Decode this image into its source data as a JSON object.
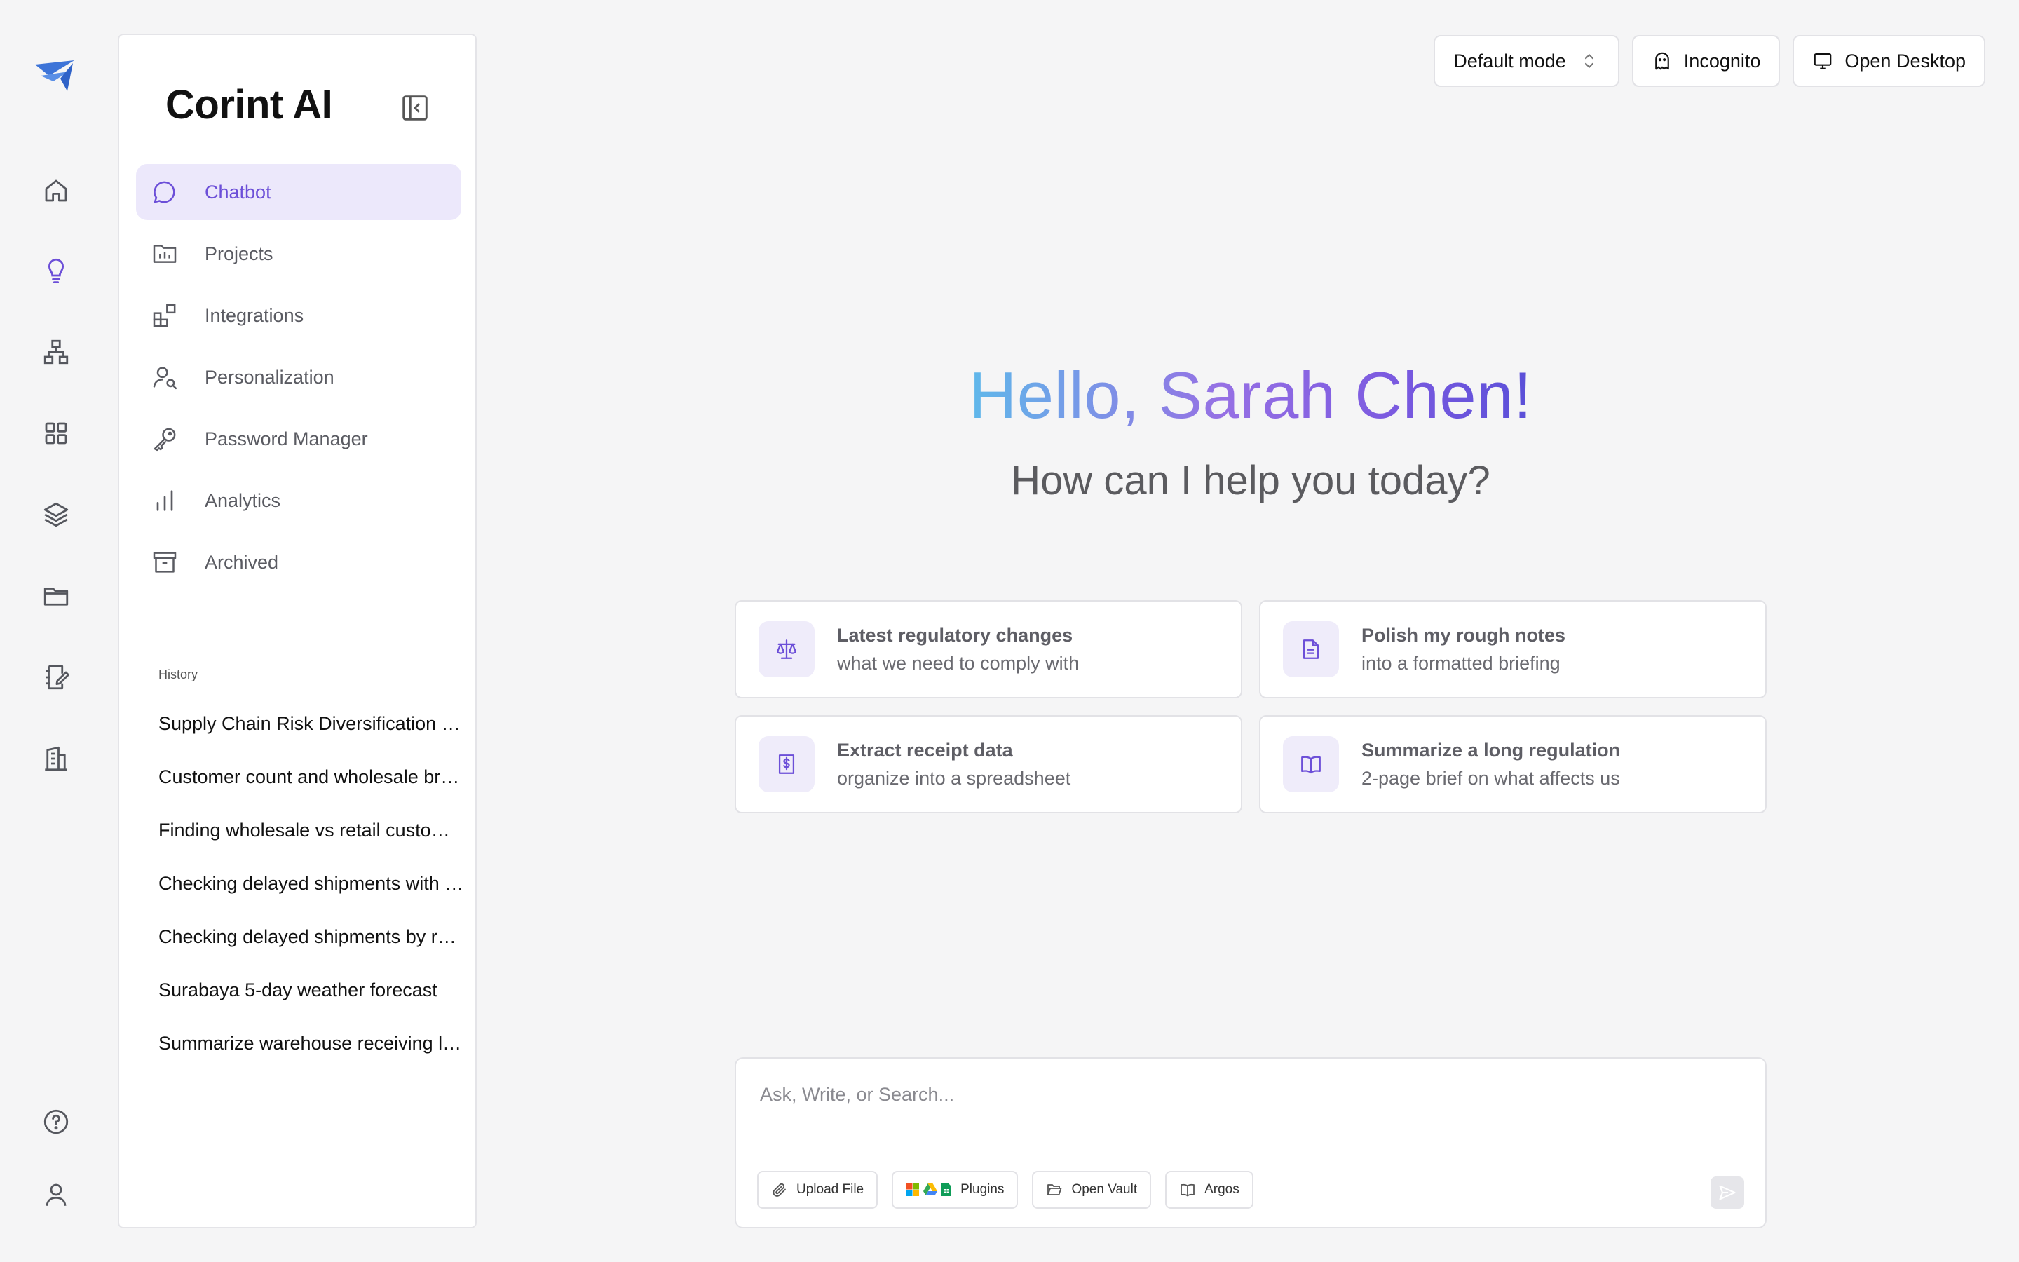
{
  "app": {
    "name": "Corint AI"
  },
  "rail": {
    "items": [
      "home-icon",
      "lightbulb-icon",
      "org-chart-icon",
      "grid-icon",
      "layers-icon",
      "folder-icon",
      "notebook-edit-icon",
      "building-icon"
    ],
    "bottom": [
      "help-icon",
      "user-icon"
    ]
  },
  "nav": {
    "items": [
      {
        "label": "Chatbot",
        "icon": "chat-bubble-icon",
        "active": true
      },
      {
        "label": "Projects",
        "icon": "folder-chart-icon"
      },
      {
        "label": "Integrations",
        "icon": "integrations-icon"
      },
      {
        "label": "Personalization",
        "icon": "user-search-icon"
      },
      {
        "label": "Password Manager",
        "icon": "key-icon"
      },
      {
        "label": "Analytics",
        "icon": "bar-chart-icon"
      },
      {
        "label": "Archived",
        "icon": "archive-icon"
      }
    ]
  },
  "history": {
    "title": "History",
    "items": [
      "Supply Chain Risk Diversification Strategy",
      "Customer count and wholesale breakdown",
      "Finding wholesale vs retail customers",
      "Checking delayed shipments with vendors",
      "Checking delayed shipments by region",
      "Surabaya 5-day weather forecast",
      "Summarize warehouse receiving logs"
    ]
  },
  "topbar": {
    "mode_label": "Default mode",
    "incognito_label": "Incognito",
    "desktop_label": "Open Desktop"
  },
  "greeting": {
    "hello": "Hello, Sarah Chen!",
    "sub": "How can I help you today?"
  },
  "suggestions": [
    {
      "line1": "Latest regulatory changes",
      "line2": "what we need to comply with",
      "icon": "scales-icon"
    },
    {
      "line1": "Polish my rough notes",
      "line2": "into a formatted briefing",
      "icon": "document-icon"
    },
    {
      "line1": "Extract receipt data",
      "line2": "organize into a spreadsheet",
      "icon": "receipt-icon"
    },
    {
      "line1": "Summarize a long regulation",
      "line2": "2-page brief on what affects us",
      "icon": "book-icon"
    }
  ],
  "composer": {
    "placeholder": "Ask, Write, or Search...",
    "upload_label": "Upload File",
    "plugins_label": "Plugins",
    "vault_label": "Open Vault",
    "argos_label": "Argos"
  },
  "colors": {
    "accent": "#6c4fd8",
    "accent_bg": "#ece8fb"
  }
}
